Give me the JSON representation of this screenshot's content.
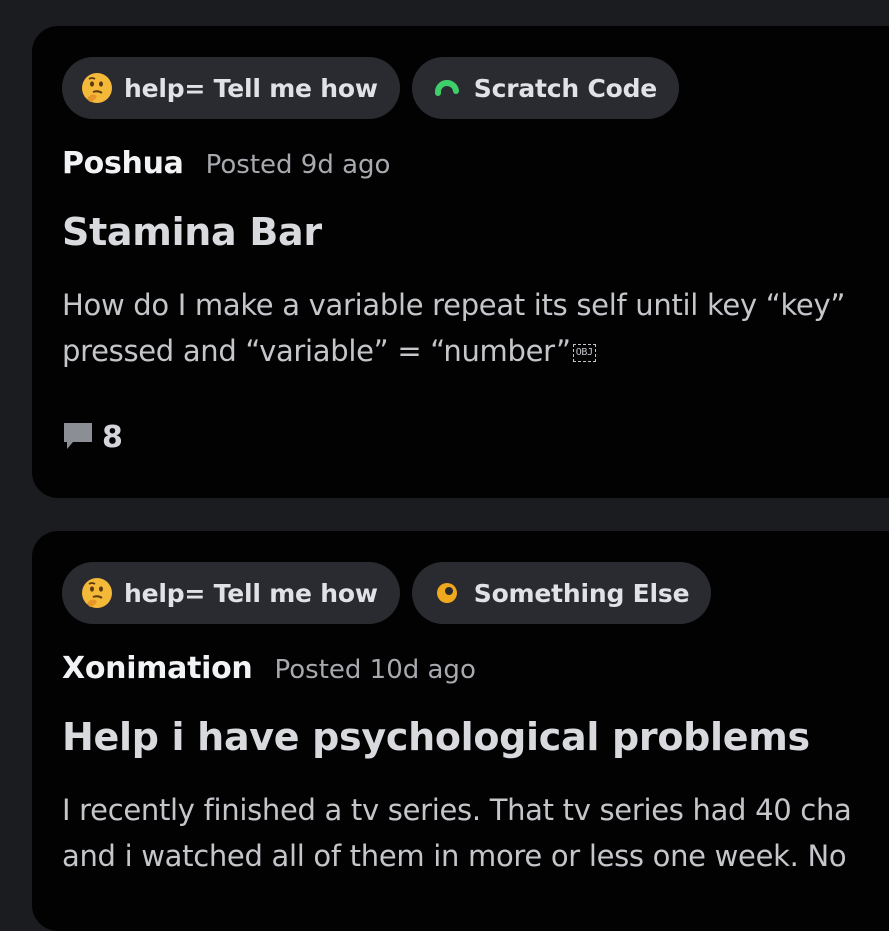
{
  "posts": [
    {
      "tags": [
        {
          "icon": "thinking-face-icon",
          "label": "help= Tell me how"
        },
        {
          "icon": "green-arc-icon",
          "label": "Scratch Code"
        }
      ],
      "author": "Poshua",
      "posted": "Posted 9d ago",
      "title": "Stamina Bar",
      "body_lines": [
        "How do I make a variable repeat its self until key “key”",
        "pressed and “variable” = “number”"
      ],
      "obj_marker": "OBJ",
      "reply_count": "8"
    },
    {
      "tags": [
        {
          "icon": "thinking-face-icon",
          "label": "help= Tell me how"
        },
        {
          "icon": "orange-swirl-icon",
          "label": "Something Else"
        }
      ],
      "author": "Xonimation",
      "posted": "Posted 10d ago",
      "title": "Help i have psychological problems",
      "body_lines": [
        "I recently finished a tv series. That tv series had 40 cha",
        "and i watched all of them in more or less one week. No"
      ]
    }
  ],
  "colors": {
    "background": "#1b1c1f",
    "card": "#020203",
    "tag": "#292b30",
    "scratch_icon": "#3ecf6b",
    "something_else_icon": "#f0a91c"
  }
}
